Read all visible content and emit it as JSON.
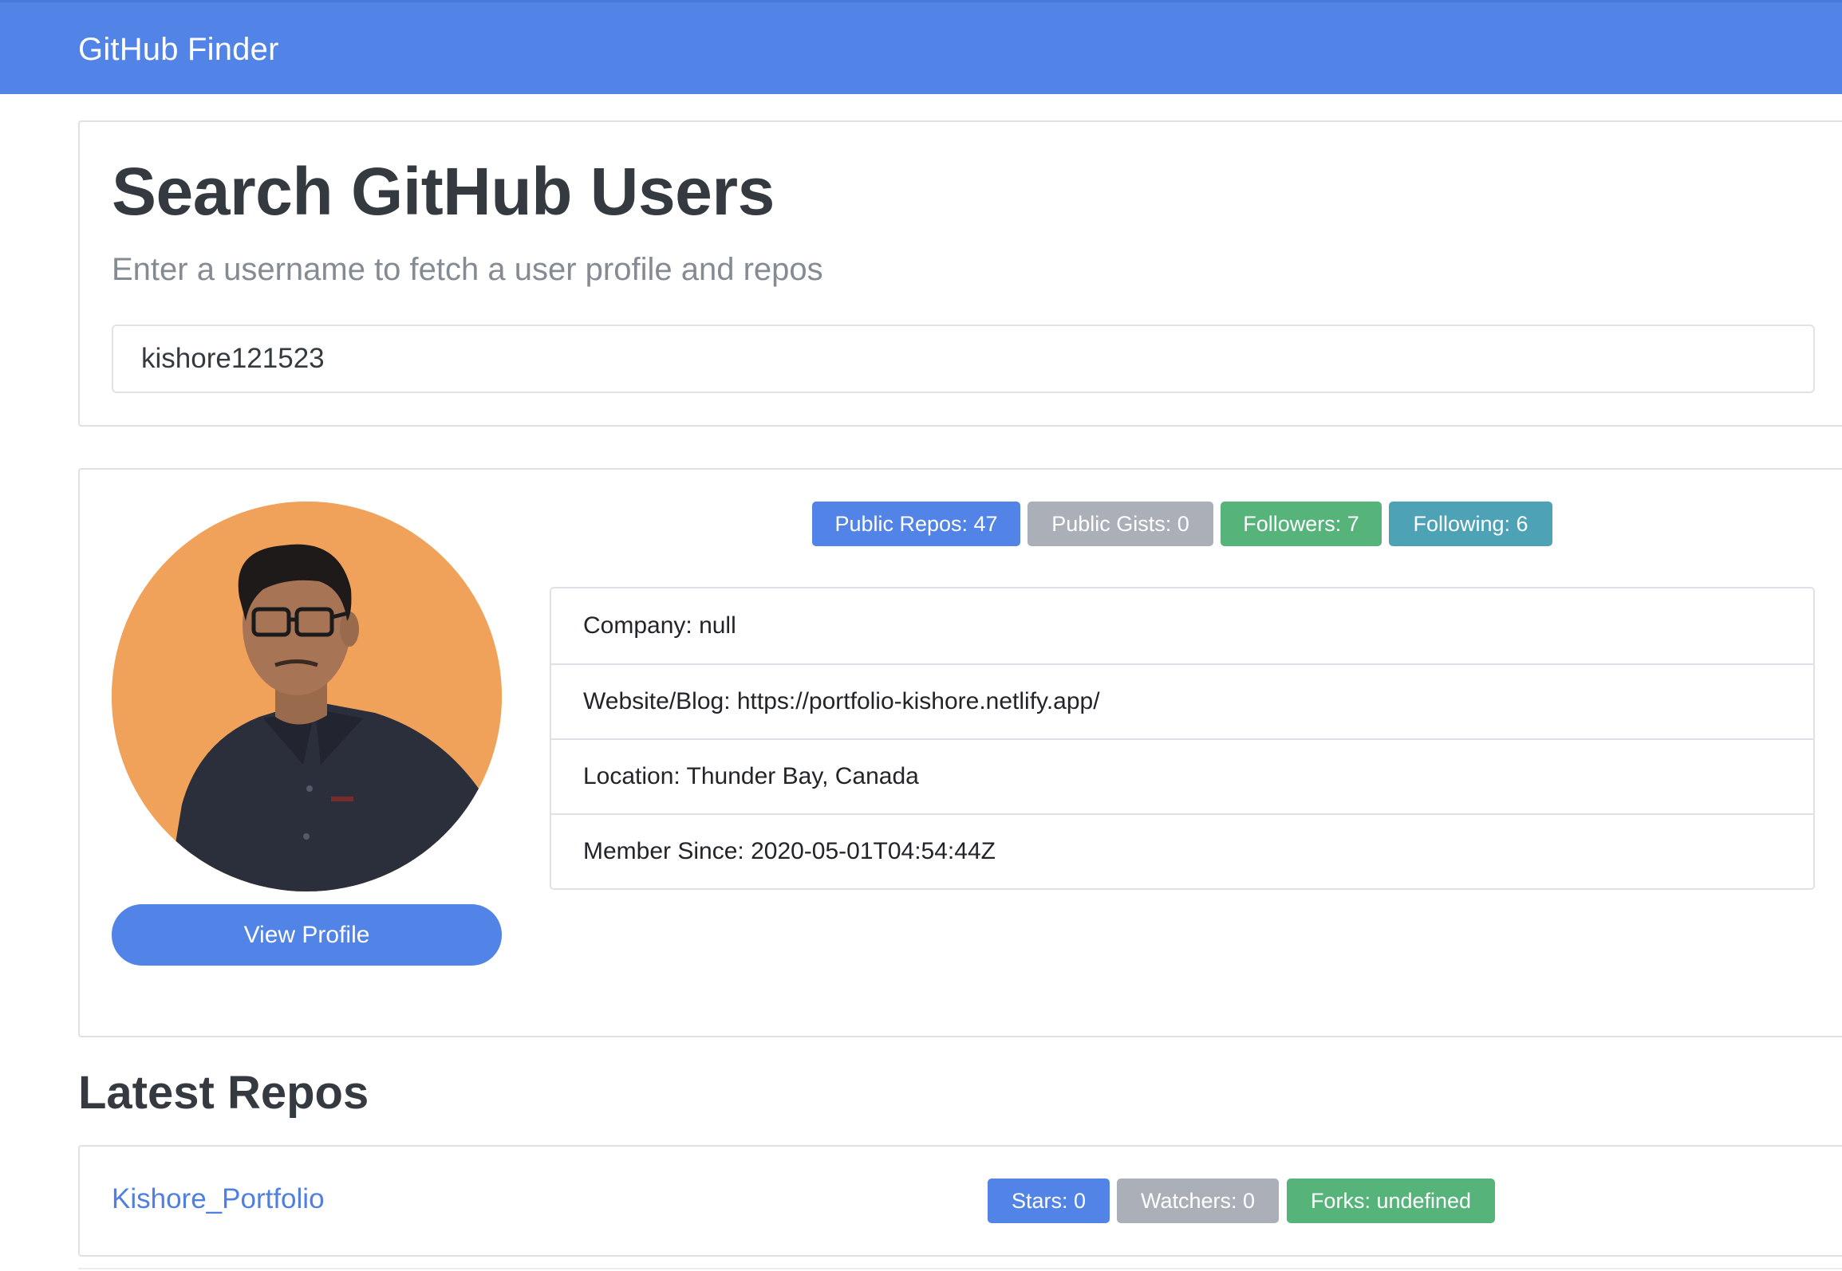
{
  "navbar": {
    "brand": "GitHub Finder"
  },
  "search": {
    "title": "Search GitHub Users",
    "subtitle": "Enter a username to fetch a user profile and repos",
    "input_value": "kishore121523"
  },
  "profile": {
    "view_profile_label": "View Profile",
    "badges": {
      "public_repos": "Public Repos: 47",
      "public_gists": "Public Gists: 0",
      "followers": "Followers: 7",
      "following": "Following: 6"
    },
    "details": {
      "company": "Company: null",
      "website": "Website/Blog: https://portfolio-kishore.netlify.app/",
      "location": "Location: Thunder Bay, Canada",
      "member_since": "Member Since: 2020-05-01T04:54:44Z"
    }
  },
  "repos": {
    "heading": "Latest Repos",
    "items": [
      {
        "name": "Kishore_Portfolio",
        "stars": "Stars: 0",
        "watchers": "Watchers: 0",
        "forks": "Forks: undefined"
      }
    ]
  },
  "colors": {
    "primary": "#5283e6",
    "secondary": "#abb0b8",
    "success": "#56b47a",
    "info": "#4ea2b5",
    "avatar_background": "#f1a25a"
  }
}
